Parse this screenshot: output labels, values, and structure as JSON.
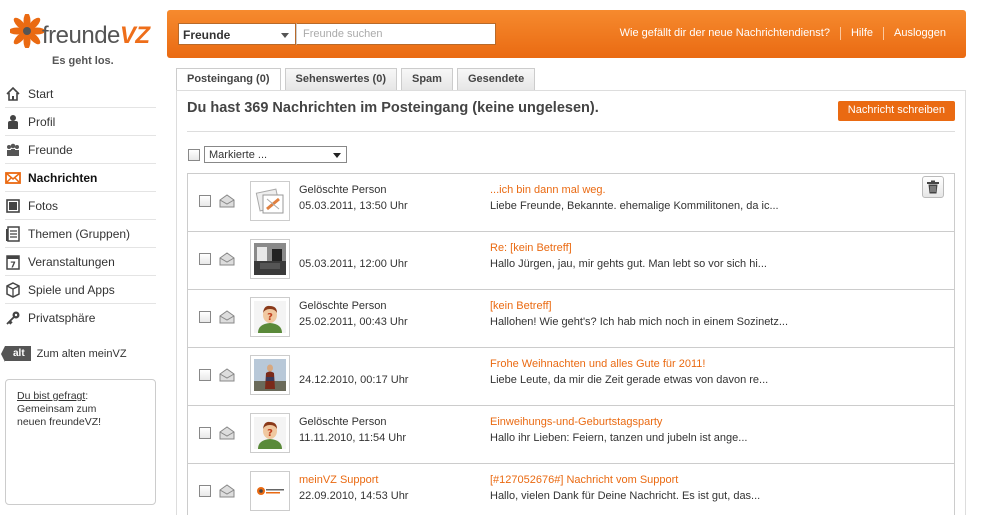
{
  "brand": {
    "name_prefix": "freunde",
    "name_suffix": "VZ",
    "claim": "Es geht los."
  },
  "colors": {
    "accent": "#ea6a12",
    "topbar_light": "#f68a2e",
    "text": "#333333"
  },
  "sidebar": {
    "items": [
      {
        "label": "Start",
        "icon": "house-icon"
      },
      {
        "label": "Profil",
        "icon": "person-icon"
      },
      {
        "label": "Freunde",
        "icon": "friends-icon"
      },
      {
        "label": "Nachrichten",
        "icon": "envelope-icon",
        "active": true
      },
      {
        "label": "Fotos",
        "icon": "photo-icon"
      },
      {
        "label": "Themen (Gruppen)",
        "icon": "document-icon"
      },
      {
        "label": "Veranstaltungen",
        "icon": "calendar-icon"
      },
      {
        "label": "Spiele und Apps",
        "icon": "cube-icon"
      },
      {
        "label": "Privatsphäre",
        "icon": "key-icon"
      }
    ],
    "old_badge": "alt",
    "old_link": "Zum alten meinVZ",
    "asked_link": "Du bist gefragt",
    "asked_colon": ":",
    "asked_line2": "Gemeinsam zum",
    "asked_line3": "neuen freundeVZ!"
  },
  "topbar": {
    "search_scope": "Freunde",
    "search_placeholder": "Freunde suchen",
    "links": [
      "Wie gefällt dir der neue Nachrichtendienst?",
      "Hilfe",
      "Ausloggen"
    ]
  },
  "tabs": [
    {
      "label": "Posteingang (0)",
      "active": true
    },
    {
      "label": "Sehenswertes (0)"
    },
    {
      "label": "Spam"
    },
    {
      "label": "Gesendete"
    }
  ],
  "inbox": {
    "headline": "Du hast 369 Nachrichten im Posteingang (keine ungelesen).",
    "compose_label": "Nachricht schreiben",
    "bulk_select": "Markierte ...",
    "messages": [
      {
        "sender": "Gelöschte Person",
        "date": "05.03.2011, 13:50 Uhr",
        "subject": "...ich bin dann mal weg.",
        "preview": "Liebe Freunde, Bekannte. ehemalige Kommilitonen, da ic...",
        "thumb": "deleted-avatar",
        "trash": true
      },
      {
        "sender": "",
        "date": "05.03.2011, 12:00 Uhr",
        "subject": "Re: [kein Betreff]",
        "preview": "Hallo Jürgen, jau, mir gehts gut. Man lebt so vor sich hi...",
        "thumb": "photo-room"
      },
      {
        "sender": "Gelöschte Person",
        "date": "25.02.2011, 00:43 Uhr",
        "subject": "[kein Betreff]",
        "preview": "Hallohen! Wie geht's? Ich hab mich noch in einem Sozinetz...",
        "thumb": "unknown-avatar"
      },
      {
        "sender": "",
        "date": "24.12.2010, 00:17 Uhr",
        "subject": "Frohe Weihnachten und alles Gute für 2011!",
        "preview": "Liebe Leute, da mir die Zeit gerade etwas von davon re...",
        "thumb": "photo-person"
      },
      {
        "sender": "Gelöschte Person",
        "date": "11.11.2010, 11:54 Uhr",
        "subject": "Einweihungs-und-Geburtstagsparty",
        "preview": "Hallo ihr Lieben: Feiern, tanzen und jubeln ist ange...",
        "thumb": "unknown-avatar"
      },
      {
        "sender": "meinVZ Support",
        "sender_orange": true,
        "date": "22.09.2010, 14:53 Uhr",
        "subject": "[#127052676#] Nachricht vom Support",
        "preview": "Hallo, vielen Dank für Deine Nachricht. Es ist gut, das...",
        "thumb": "freundevz-logo"
      }
    ]
  }
}
